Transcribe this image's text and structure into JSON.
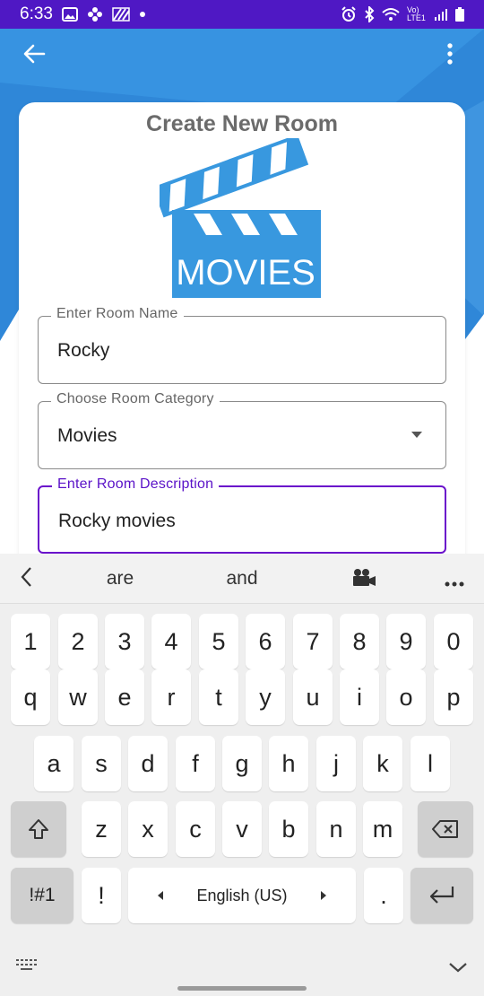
{
  "status_bar": {
    "time": "6:33",
    "network_label": "Vo) LTE1"
  },
  "app": {
    "title": "Create New Room",
    "logo_text": "MOVIES",
    "fields": {
      "room_name": {
        "label": "Enter Room Name",
        "value": "Rocky"
      },
      "room_category": {
        "label": "Choose Room Category",
        "value": "Movies"
      },
      "room_description": {
        "label": "Enter Room Description",
        "value": "Rocky movies"
      }
    }
  },
  "keyboard": {
    "suggestions": [
      "are",
      "and"
    ],
    "number_row": [
      "1",
      "2",
      "3",
      "4",
      "5",
      "6",
      "7",
      "8",
      "9",
      "0"
    ],
    "row1": [
      "q",
      "w",
      "e",
      "r",
      "t",
      "y",
      "u",
      "i",
      "o",
      "p"
    ],
    "row2": [
      "a",
      "s",
      "d",
      "f",
      "g",
      "h",
      "j",
      "k",
      "l"
    ],
    "row3": [
      "z",
      "x",
      "c",
      "v",
      "b",
      "n",
      "m"
    ],
    "symbols_key": "!#1",
    "exclaim_key": "!",
    "space_label": "English (US)",
    "period_key": "."
  },
  "colors": {
    "status_bar": "#4f18c4",
    "header": "#3f95e0",
    "focus": "#6a11cb"
  }
}
